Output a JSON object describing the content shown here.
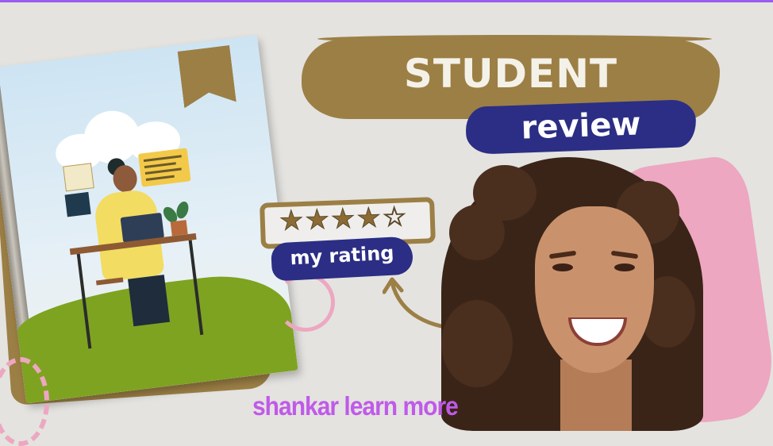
{
  "title": {
    "line1": "STUDENT",
    "line2": "review"
  },
  "rating": {
    "label": "my rating",
    "value": 4,
    "max": 5,
    "star_full": "★",
    "star_empty": "☆"
  },
  "brand": {
    "text": "shankar learn more"
  },
  "colors": {
    "accent_gold": "#9c7f45",
    "accent_navy": "#2b2e84",
    "accent_pink": "#eda7c1",
    "brand_purple": "#c05ae8",
    "background": "#e4e3e0"
  }
}
